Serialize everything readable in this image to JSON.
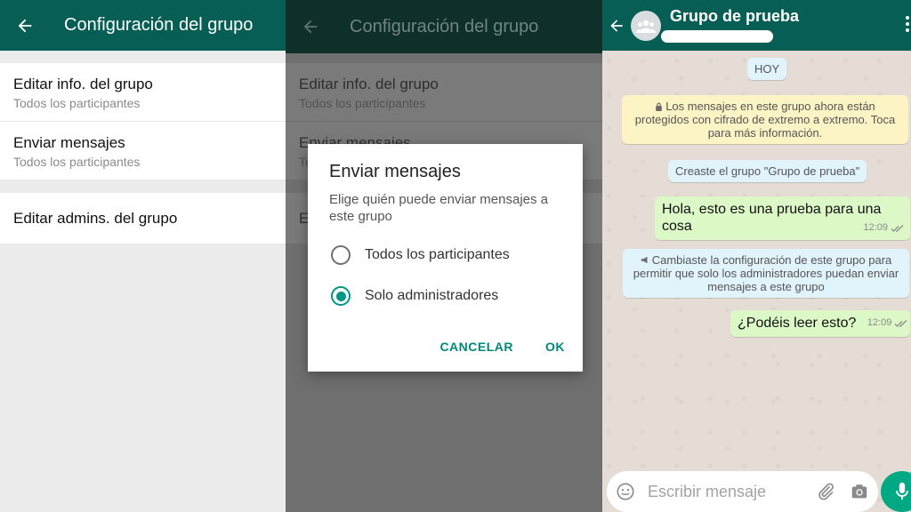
{
  "settings": {
    "title": "Configuración del grupo",
    "rows": [
      {
        "primary": "Editar info. del grupo",
        "secondary": "Todos los participantes"
      },
      {
        "primary": "Enviar mensajes",
        "secondary": "Todos los participantes"
      }
    ],
    "admins_row": "Editar admins. del grupo"
  },
  "dialog": {
    "title": "Enviar mensajes",
    "message": "Elige quién puede enviar mensajes a este grupo",
    "options": [
      {
        "label": "Todos los participantes",
        "checked": false
      },
      {
        "label": "Solo administradores",
        "checked": true
      }
    ],
    "cancel_label": "CANCELAR",
    "ok_label": "OK"
  },
  "chat": {
    "title": "Grupo de prueba",
    "day_label": "HOY",
    "encryption_notice": "Los mensajes en este grupo ahora están protegidos con cifrado de extremo a extremo. Toca para más información.",
    "created_notice": "Creaste el grupo \"Grupo de prueba\"",
    "messages": [
      {
        "text": "Hola, esto es una prueba para una cosa",
        "time": "12:09"
      },
      {
        "text": "¿Podéis leer esto?",
        "time": "12:09"
      }
    ],
    "settings_change_notice": "Cambiaste la configuración de este grupo para permitir que solo los administradores puedan enviar mensajes a este grupo",
    "input_placeholder": "Escribir mensaje"
  },
  "colors": {
    "header": "#075e54",
    "accent": "#009688",
    "outgoing_bubble": "#dcf8c6",
    "system_bubble": "#e1f3fb",
    "encryption_bubble": "#fdf4c5"
  }
}
